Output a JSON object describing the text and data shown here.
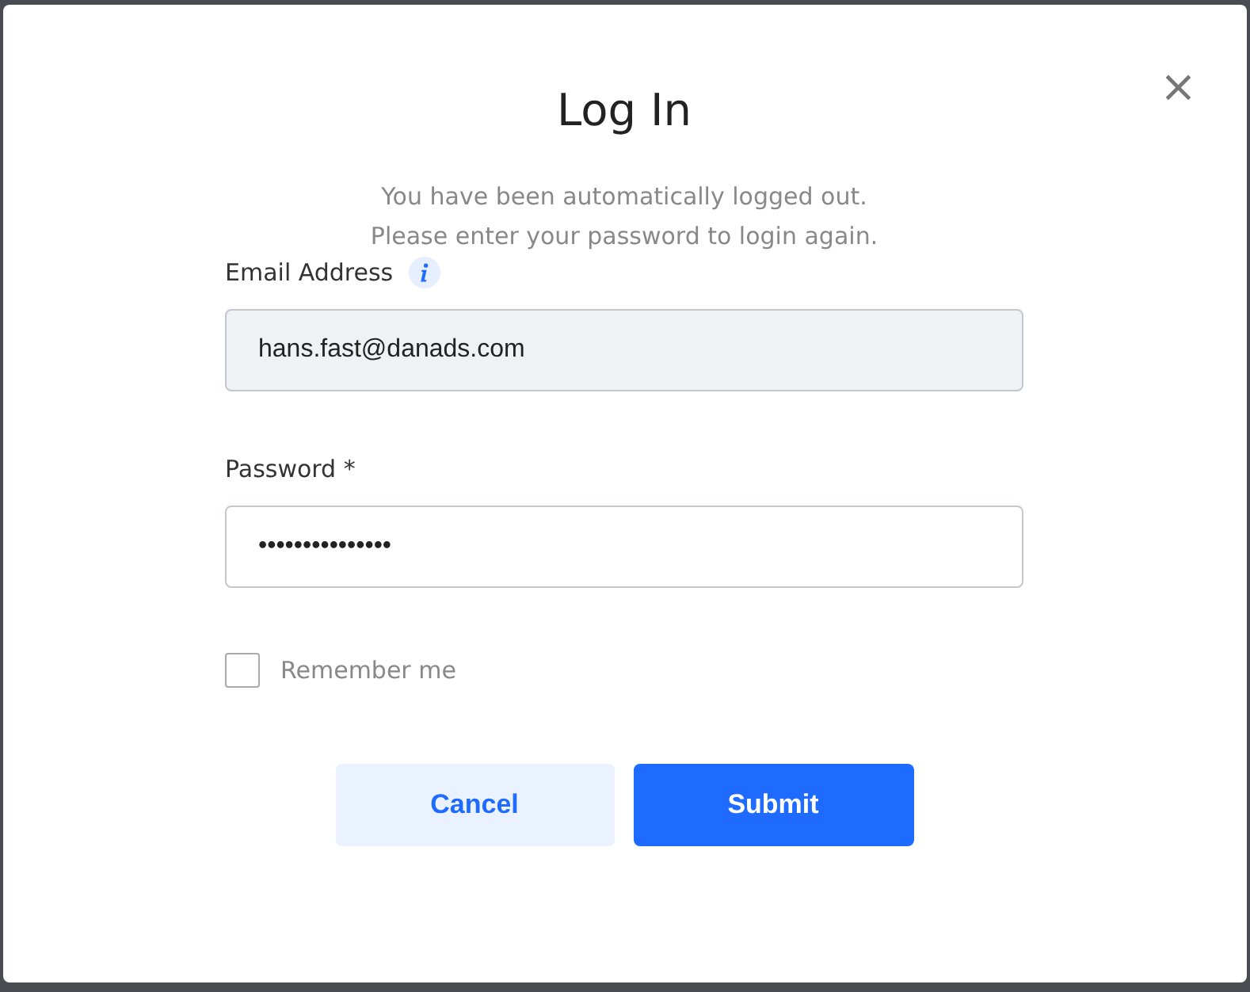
{
  "dialog": {
    "title": "Log In",
    "message_lines": [
      "You have been automatically logged out.",
      "Please enter your password to login again."
    ],
    "close_icon": "×",
    "email": {
      "label": "Email Address",
      "value": "hans.fast@danads.com",
      "disabled": true
    },
    "password": {
      "label": "Password *",
      "value": "•••••••••••••••"
    },
    "remember": {
      "label": "Remember me",
      "checked": false
    },
    "buttons": [
      {
        "label": "Cancel",
        "kind": "secondary"
      },
      {
        "label": "Submit",
        "kind": "primary"
      }
    ]
  }
}
